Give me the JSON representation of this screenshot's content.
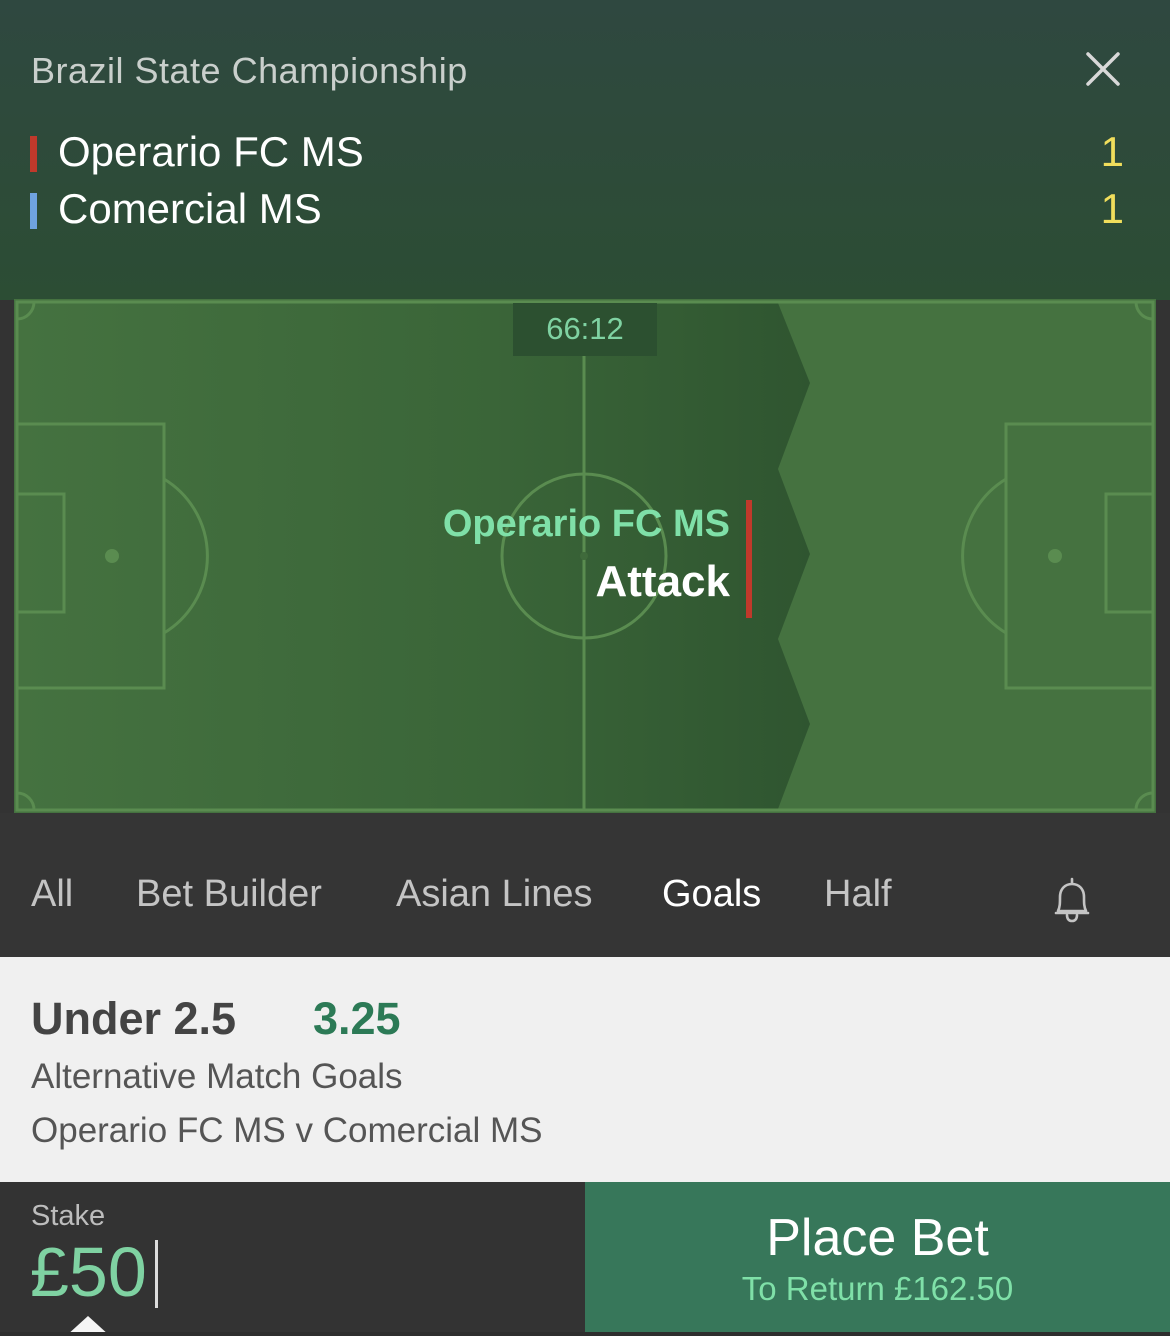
{
  "header": {
    "competition": "Brazil State Championship",
    "home": {
      "name": "Operario FC MS",
      "score": "1",
      "color": "#c0392b"
    },
    "away": {
      "name": "Comercial MS",
      "score": "1",
      "color": "#6fa3e0"
    }
  },
  "pitch": {
    "clock": "66:12",
    "team": "Operario FC MS",
    "status": "Attack",
    "colors": {
      "light": "#457240",
      "dark": "#365f37",
      "line": "#5a8c50",
      "accent": "#7fe0a8"
    }
  },
  "tabs": [
    {
      "label": "All",
      "active": false
    },
    {
      "label": "Bet Builder",
      "active": false
    },
    {
      "label": "Asian Lines",
      "active": false
    },
    {
      "label": "Goals",
      "active": true
    },
    {
      "label": "Half",
      "active": false
    }
  ],
  "selection": {
    "name": "Under 2.5",
    "odds": "3.25",
    "market": "Alternative Match Goals",
    "event": "Operario FC MS v Comercial MS"
  },
  "stake": {
    "label": "Stake",
    "value": "£50"
  },
  "place_bet": {
    "label": "Place Bet",
    "return": "To Return £162.50"
  },
  "icons": {
    "close": "close-icon",
    "bell": "bell-icon"
  }
}
